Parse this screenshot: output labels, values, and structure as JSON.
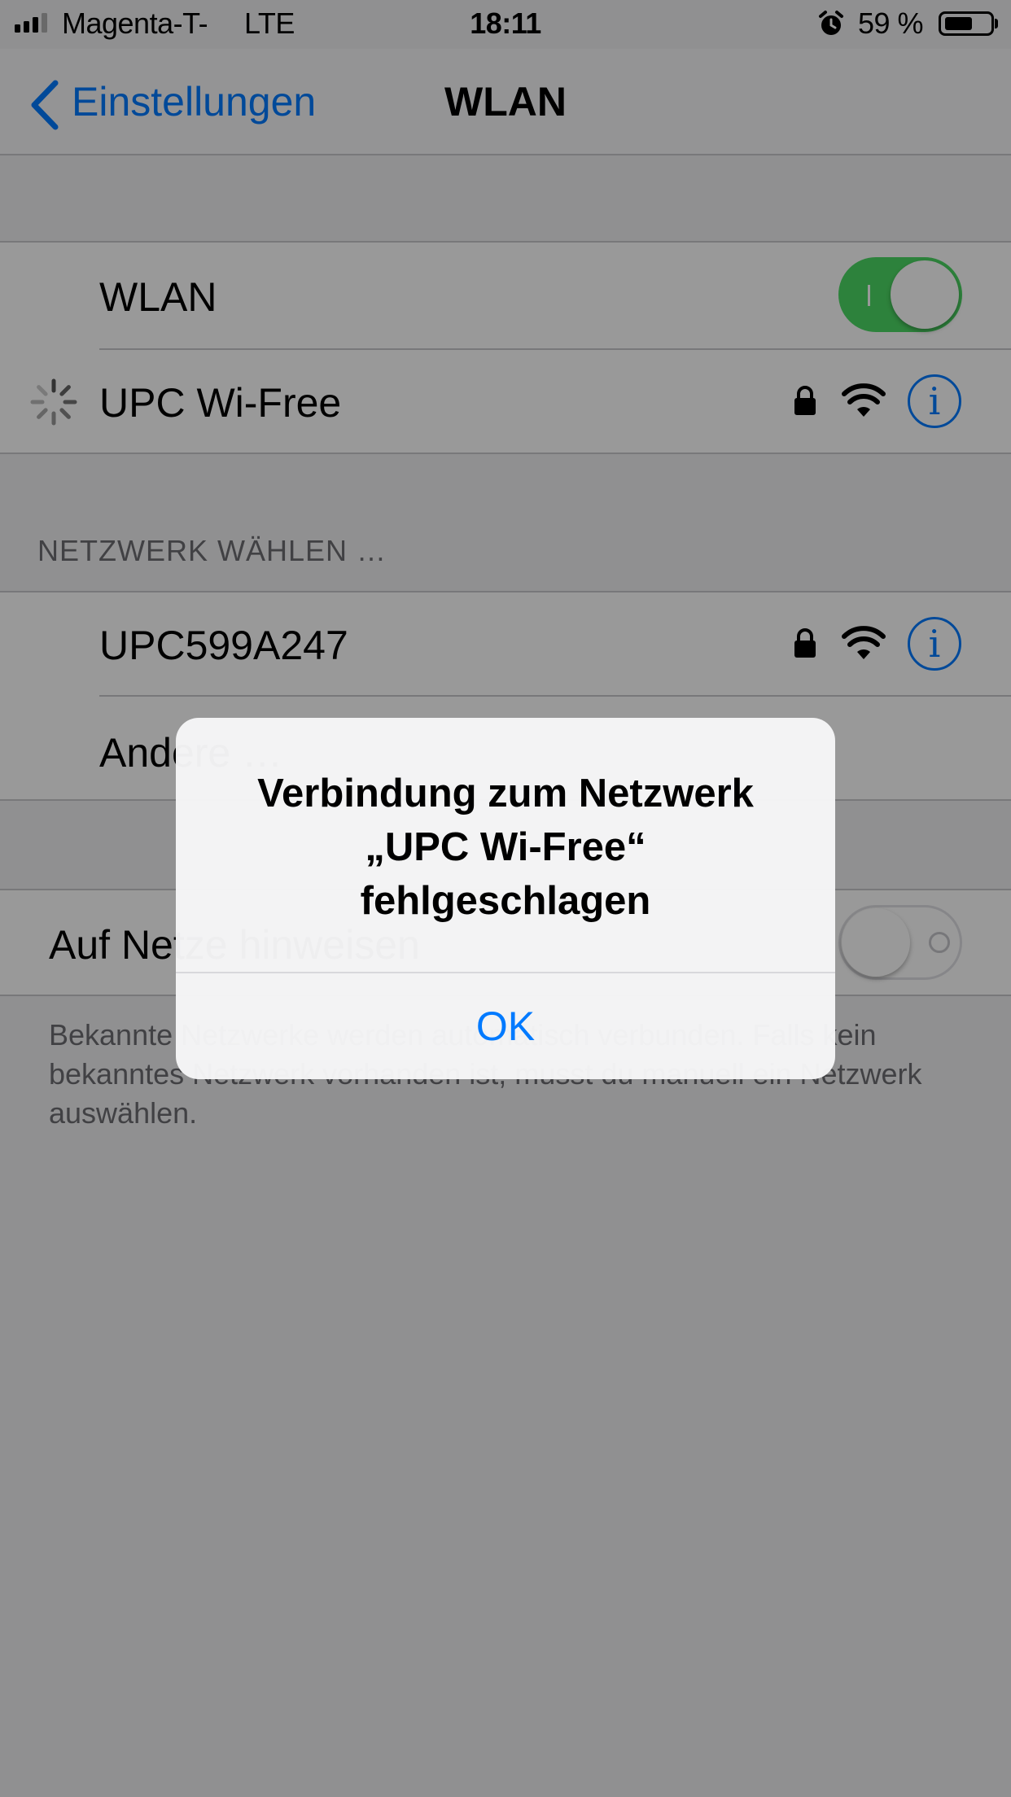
{
  "status_bar": {
    "carrier": "Magenta-T-",
    "network": "LTE",
    "time": "18:11",
    "battery_percent": "59 %",
    "battery_level": 0.59
  },
  "nav": {
    "back_label": "Einstellungen",
    "title": "WLAN"
  },
  "wlan_group": {
    "toggle_label": "WLAN",
    "toggle_on": true,
    "current_network": "UPC Wi-Free"
  },
  "section_header": "NETZWERK WÄHLEN …",
  "networks": [
    {
      "name": "UPC599A247"
    },
    {
      "name": "Andere …"
    }
  ],
  "ask_group": {
    "label": "Auf Netze hinweisen",
    "toggle_on": false
  },
  "footer": "Bekannte Netzwerke werden automatisch verbunden. Falls kein bekanntes Netzwerk vorhanden ist, musst du manuell ein Netzwerk auswählen.",
  "alert": {
    "title_line1": "Verbindung zum Netzwerk",
    "title_line2": "„UPC Wi-Free“",
    "title_line3": "fehlgeschlagen",
    "ok_label": "OK"
  },
  "colors": {
    "accent": "#007aff",
    "switch_on": "#4cd964",
    "secondary_text": "#6d6d72"
  },
  "icons": [
    "chevron-left-icon",
    "lock-icon",
    "wifi-icon",
    "info-icon",
    "spinner-icon",
    "alarm-icon",
    "battery-icon",
    "signal-icon"
  ]
}
